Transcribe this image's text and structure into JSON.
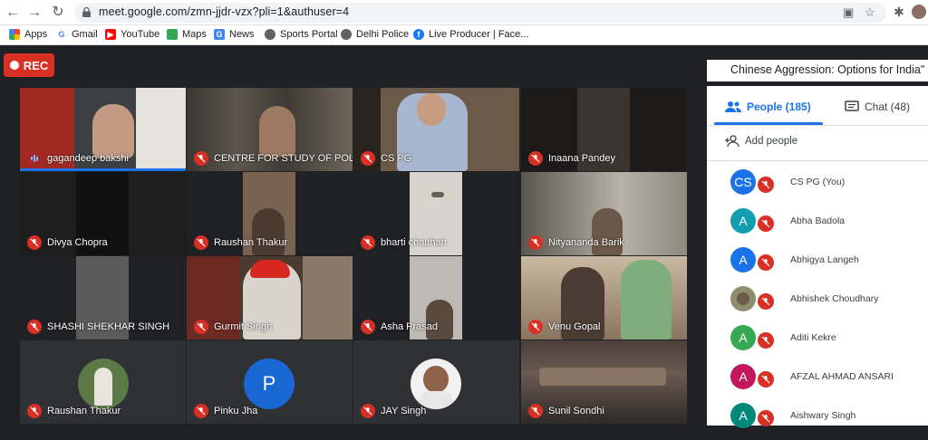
{
  "browser": {
    "url": "meet.google.com/zmn-jjdr-vzx?pli=1&authuser=4",
    "bookmarks": [
      "Apps",
      "Gmail",
      "YouTube",
      "Maps",
      "News",
      "Sports Portal",
      "Delhi Police",
      "Live Producer | Face..."
    ]
  },
  "meeting": {
    "rec_label": "REC",
    "title": "Chinese Aggression: Options for India\""
  },
  "tiles": [
    {
      "name": "gagandeep bakshi",
      "bg": "#5a3a32",
      "speaking": true
    },
    {
      "name": "CENTRE FOR STUDY OF POL",
      "bg": "#4a4540"
    },
    {
      "name": "CS PG",
      "bg": "#6b5a48"
    },
    {
      "name": "Inaana Pandey",
      "bg": "#2a2a2a"
    },
    {
      "name": "Divya Chopra",
      "bg": "#232323"
    },
    {
      "name": "Raushan Thakur",
      "bg": "#3d3530"
    },
    {
      "name": "bharti chauhan",
      "bg": "#5e5850"
    },
    {
      "name": "Nityananda Barik",
      "bg": "#6a665f"
    },
    {
      "name": "SHASHI SHEKHAR SINGH",
      "bg": "#3b3b3b"
    },
    {
      "name": "Gurmit Singh",
      "bg": "#4a3a30"
    },
    {
      "name": "Asha Prasad",
      "bg": "#444040"
    },
    {
      "name": "Venu Gopal",
      "bg": "#7a6a55"
    },
    {
      "name": "Raushan Thakur",
      "bg": "#303134"
    },
    {
      "name": "Pinku Jha",
      "bg": "#303134"
    },
    {
      "name": "JAY Singh",
      "bg": "#303134"
    },
    {
      "name": "Sunil Sondhi",
      "bg": "#3a3431"
    }
  ],
  "avatars": {
    "pinku_letter": "P"
  },
  "panel": {
    "people_tab": "People (185)",
    "chat_tab": "Chat (48)",
    "add_people": "Add people",
    "people": [
      {
        "initials": "CS",
        "name": "CS PG (You)",
        "color": "#1a73e8"
      },
      {
        "initials": "A",
        "name": "Abha Badola",
        "color": "#129eaf"
      },
      {
        "initials": "A",
        "name": "Abhigya Langeh",
        "color": "#1a73e8"
      },
      {
        "initials": "",
        "name": "Abhishek Choudhary",
        "color": "#8d8d70"
      },
      {
        "initials": "A",
        "name": "Aditi Kekre",
        "color": "#34a853"
      },
      {
        "initials": "A",
        "name": "AFZAL AHMAD ANSARI",
        "color": "#c2185b"
      },
      {
        "initials": "A",
        "name": "Aishwary Singh",
        "color": "#00897b"
      }
    ]
  }
}
